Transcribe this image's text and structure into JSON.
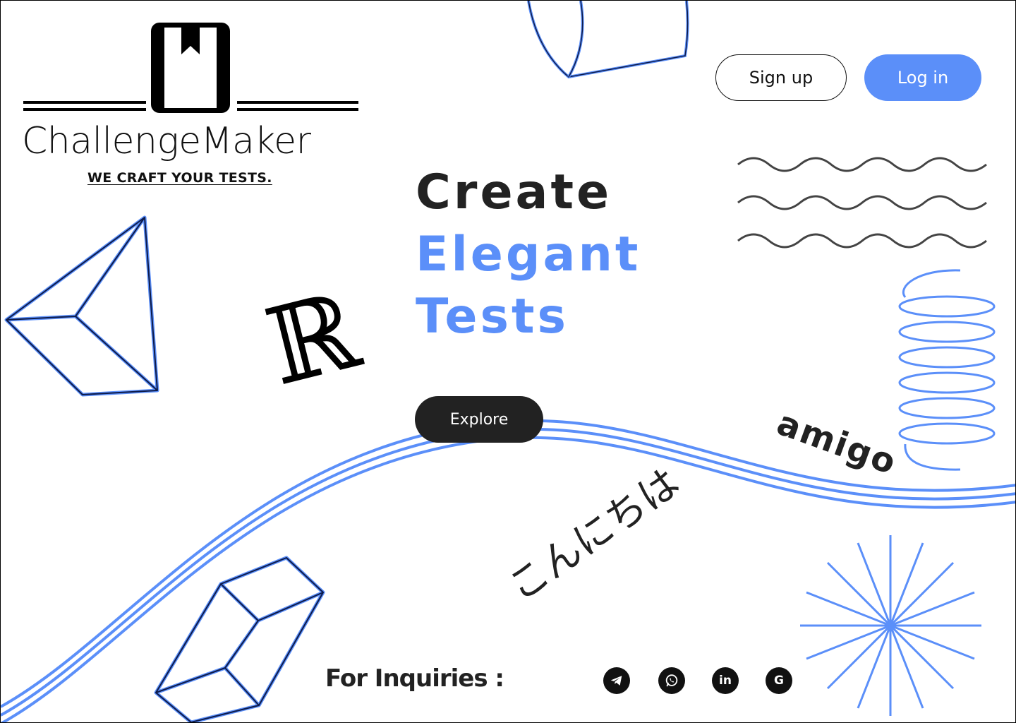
{
  "brand": {
    "name": "ChallengeMaker",
    "tagline": "WE CRAFT YOUR TESTS."
  },
  "header": {
    "signup_label": "Sign up",
    "login_label": "Log in"
  },
  "hero": {
    "line1": "Create",
    "line2": "Elegant",
    "line3": "Tests",
    "explore_label": "Explore"
  },
  "decor": {
    "letter": "ℝ",
    "word_spanish": "amigo",
    "word_japanese": "こんにちは"
  },
  "footer": {
    "inquiries_label": "For Inquiries :",
    "socials": [
      {
        "name": "telegram",
        "icon": "telegram-icon"
      },
      {
        "name": "whatsapp",
        "icon": "whatsapp-icon"
      },
      {
        "name": "linkedin",
        "icon": "linkedin-icon",
        "glyph": "in"
      },
      {
        "name": "google",
        "icon": "google-icon",
        "glyph": "G"
      }
    ]
  },
  "colors": {
    "accent": "#5b8ff9",
    "dark": "#222222",
    "background": "#ffffff"
  }
}
